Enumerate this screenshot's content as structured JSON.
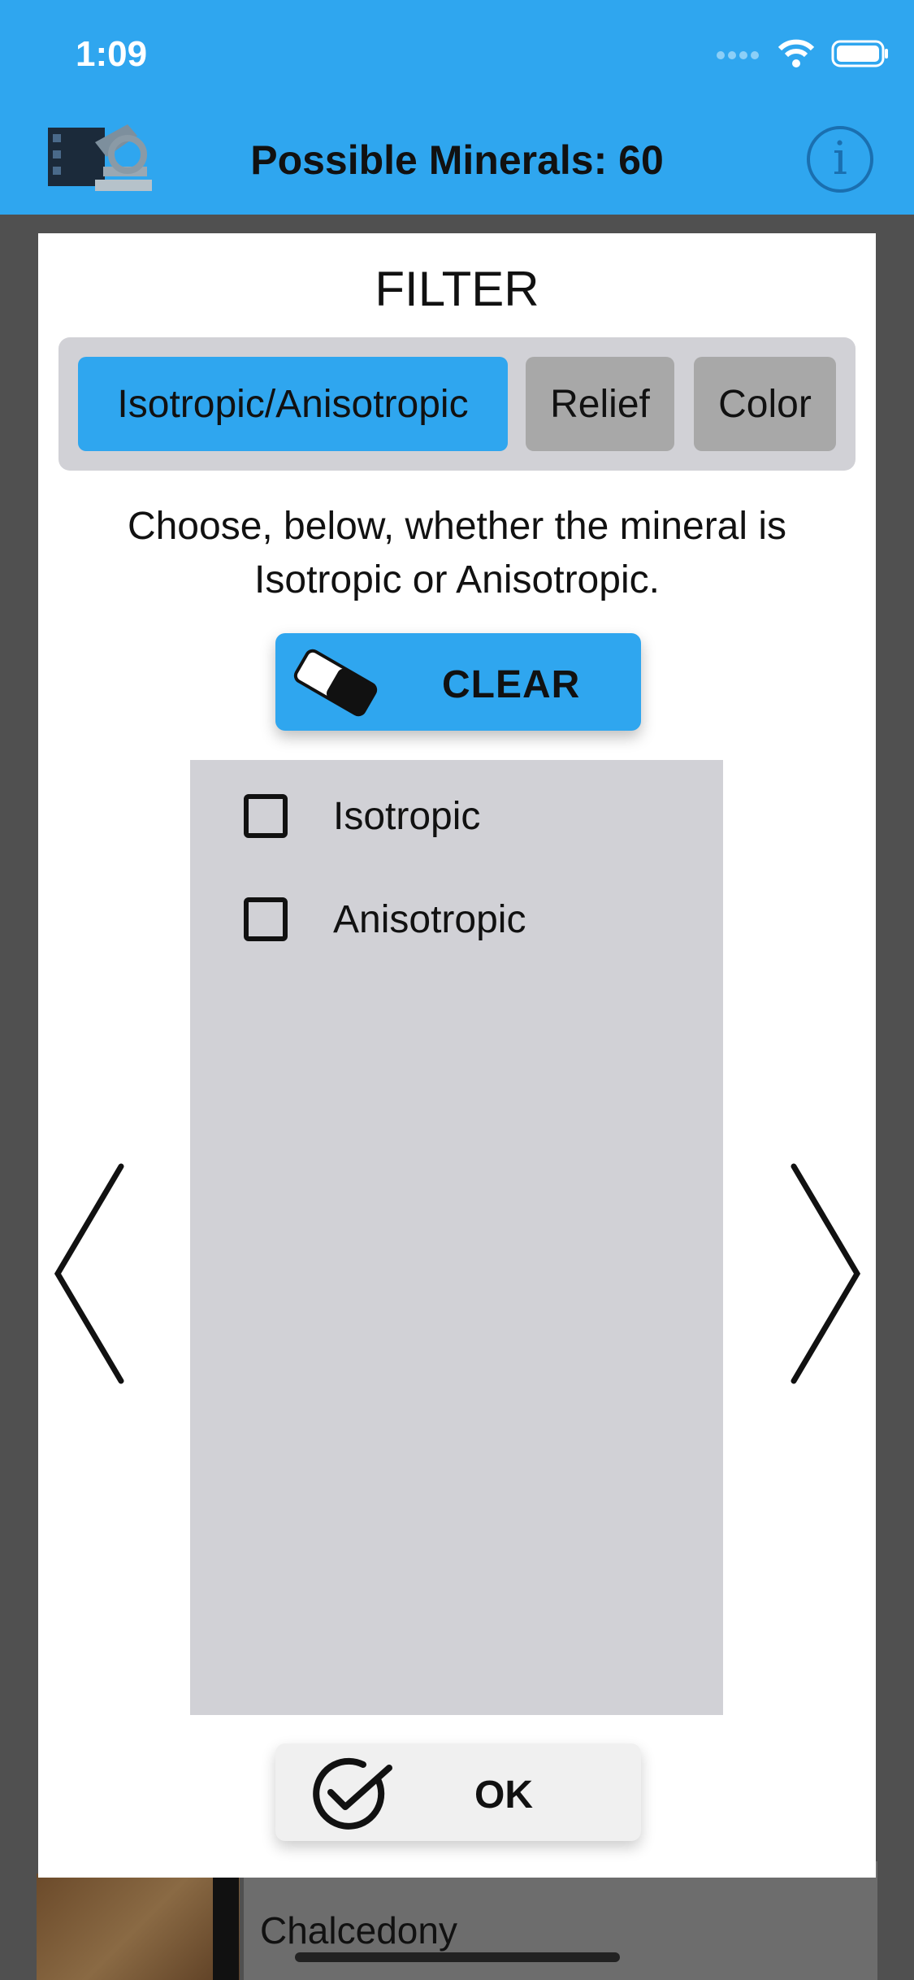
{
  "status_bar": {
    "time": "1:09"
  },
  "nav": {
    "title": "Possible Minerals: 60"
  },
  "background_list": {
    "item_label": "Chalcedony"
  },
  "filter": {
    "title": "FILTER",
    "tabs": [
      {
        "label": "Isotropic/Anisotropic",
        "active": true
      },
      {
        "label": "Relief",
        "active": false
      },
      {
        "label": "Color",
        "active": false
      }
    ],
    "instructions": "Choose, below, whether the mineral is Isotropic or Anisotropic.",
    "clear_label": "CLEAR",
    "options": [
      {
        "label": "Isotropic",
        "checked": false
      },
      {
        "label": "Anisotropic",
        "checked": false
      }
    ],
    "ok_label": "OK"
  },
  "colors": {
    "accent": "#2fa6ef",
    "panel": "#d1d1d6",
    "inactive_tab": "#a8a8a8"
  }
}
